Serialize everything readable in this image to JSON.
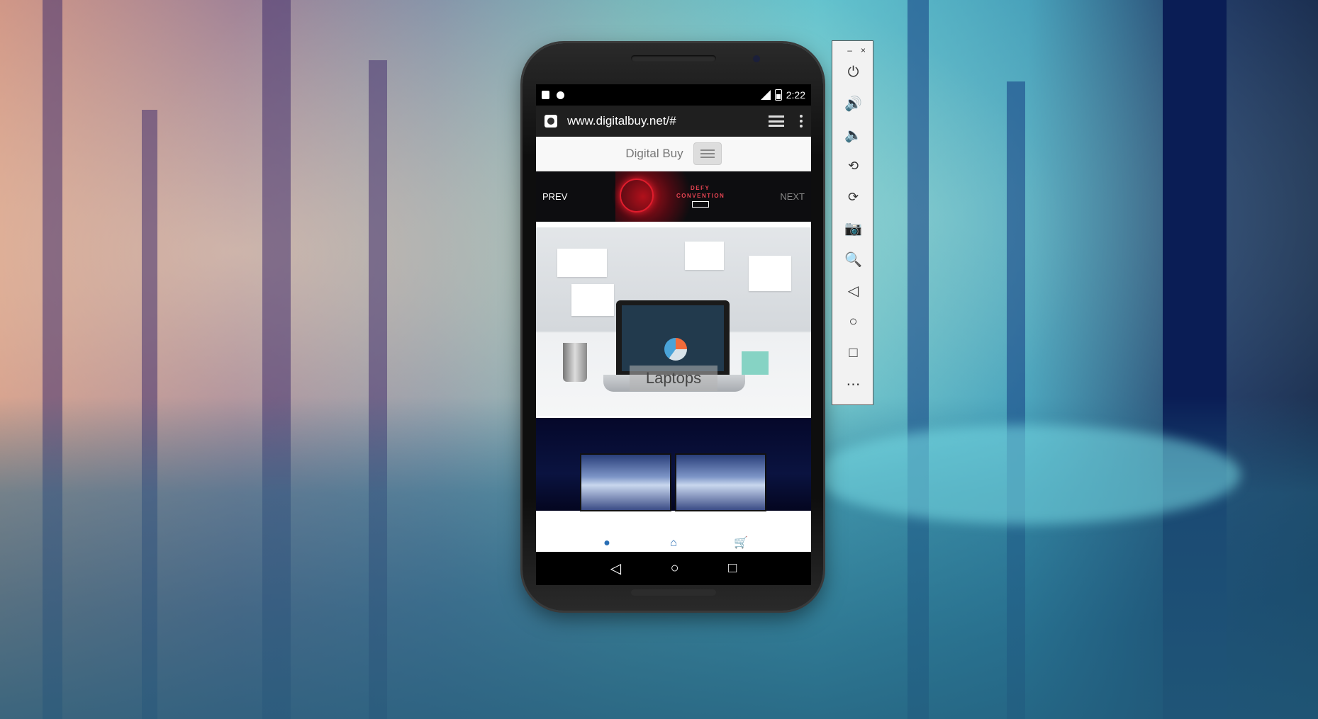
{
  "statusbar": {
    "time": "2:22"
  },
  "browser": {
    "url": "www.digitalbuy.net/#"
  },
  "site": {
    "brand": "Digital Buy",
    "carousel": {
      "prev": "PREV",
      "next": "NEXT",
      "banner_line1": "DEFY",
      "banner_line2": "CONVENTION"
    },
    "category_caption": "Laptops"
  },
  "bottom_nav": {
    "info_icon": "info-icon",
    "home_icon": "home-icon",
    "cart_icon": "cart-icon"
  },
  "android_nav": {
    "back": "◁",
    "home": "○",
    "recents": "□"
  },
  "emulator_toolbar": {
    "minimize": "–",
    "close": "×",
    "buttons": [
      "power-icon",
      "volume-up-icon",
      "volume-down-icon",
      "rotate-left-icon",
      "rotate-right-icon",
      "camera-icon",
      "zoom-icon",
      "back-icon",
      "home-icon",
      "overview-icon",
      "more-icon"
    ]
  },
  "colors": {
    "accent": "#2a6fb5",
    "banner_red": "#e01c2c"
  }
}
